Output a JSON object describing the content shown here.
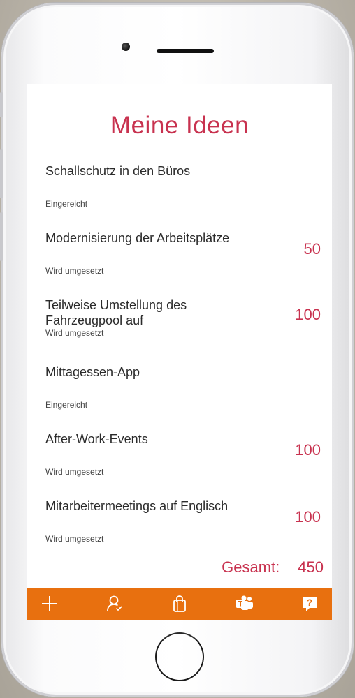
{
  "app": {
    "title": "Meine Ideen"
  },
  "ideas": [
    {
      "name": "Schallschutz in den Büros",
      "status": "Eingereicht",
      "points": ""
    },
    {
      "name": "Modernisierung der Arbeitsplätze",
      "status": "Wird umgesetzt",
      "points": "50"
    },
    {
      "name": "Teilweise Umstellung des Fahrzeugpool auf",
      "status": "Wird umgesetzt",
      "points": "100"
    },
    {
      "name": "Mittagessen-App",
      "status": "Eingereicht",
      "points": ""
    },
    {
      "name": "After-Work-Events",
      "status": "Wird umgesetzt",
      "points": "100"
    },
    {
      "name": "Mitarbeitermeetings auf Englisch",
      "status": "Wird umgesetzt",
      "points": "100"
    }
  ],
  "summary": {
    "label": "Gesamt:",
    "value": "450"
  },
  "toolbar": {
    "icons": [
      "plus-icon",
      "user-icon",
      "shopping-bag-icon",
      "teams-icon",
      "help-icon"
    ],
    "help_glyph": "?"
  },
  "colors": {
    "accent": "#c8324f",
    "toolbar": "#e8700f"
  }
}
